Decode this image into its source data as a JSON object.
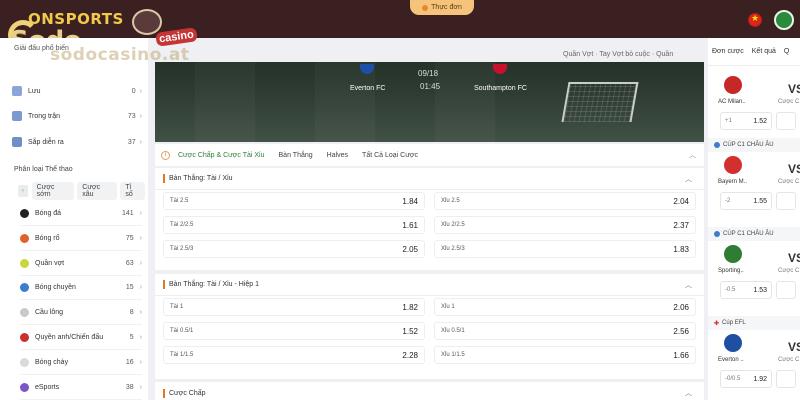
{
  "header": {
    "brand_top": "ONSPORTS",
    "brand_main": "Sodo",
    "brand_badge": "casino",
    "watermark": "sodocasino.at",
    "menu_label": "Thực đơn"
  },
  "sidebar": {
    "header": "Giải đấu phổ biến",
    "quick": [
      {
        "label": "Lưu",
        "count": "0"
      },
      {
        "label": "Trong trận",
        "count": "73"
      },
      {
        "label": "Sắp diễn ra",
        "count": "37"
      }
    ],
    "section_title": "Phân loại Thể thao",
    "filters": [
      "Cược sớm",
      "Cược xâu",
      "Tỉ số"
    ],
    "sports": [
      {
        "label": "Bóng đá",
        "count": "141",
        "color": "#222222"
      },
      {
        "label": "Bóng rổ",
        "count": "75",
        "color": "#e0622b"
      },
      {
        "label": "Quần vợt",
        "count": "63",
        "color": "#c6d83a"
      },
      {
        "label": "Bóng chuyền",
        "count": "15",
        "color": "#3b7bd0"
      },
      {
        "label": "Cầu lông",
        "count": "8",
        "color": "#c9c9c9"
      },
      {
        "label": "Quyền anh/Chiến đấu",
        "count": "5",
        "color": "#c93030"
      },
      {
        "label": "Bóng chày",
        "count": "16",
        "color": "#d9d9d9"
      },
      {
        "label": "eSports",
        "count": "38",
        "color": "#7a58c6"
      }
    ]
  },
  "crumb_right": "Quần Vợt · Tay Vợt bỏ cuộc · Quần",
  "match": {
    "home": "Everton FC",
    "away": "Southampton FC",
    "date": "09/18",
    "time": "01:45"
  },
  "market_tabs": [
    "Cược Chấp & Cược Tài Xỉu",
    "Bàn Thắng",
    "Halves",
    "Tất Cả Loại Cược"
  ],
  "markets": [
    {
      "title": "Bàn Thắng: Tài / Xỉu",
      "rows": [
        [
          {
            "label": "Tài 2.5",
            "value": "1.84"
          },
          {
            "label": "Xỉu 2.5",
            "value": "2.04"
          }
        ],
        [
          {
            "label": "Tài 2/2.5",
            "value": "1.61"
          },
          {
            "label": "Xỉu 2/2.5",
            "value": "2.37"
          }
        ],
        [
          {
            "label": "Tài 2.5/3",
            "value": "2.05"
          },
          {
            "label": "Xỉu 2.5/3",
            "value": "1.83"
          }
        ]
      ]
    },
    {
      "title": "Bàn Thắng: Tài / Xỉu - Hiệp 1",
      "rows": [
        [
          {
            "label": "Tài 1",
            "value": "1.82"
          },
          {
            "label": "Xỉu 1",
            "value": "2.06"
          }
        ],
        [
          {
            "label": "Tài 0.5/1",
            "value": "1.52"
          },
          {
            "label": "Xỉu 0.5/1",
            "value": "2.56"
          }
        ],
        [
          {
            "label": "Tài 1/1.5",
            "value": "2.28"
          },
          {
            "label": "Xỉu 1/1.5",
            "value": "1.66"
          }
        ]
      ]
    },
    {
      "title": "Cược Chấp",
      "rows": []
    }
  ],
  "right": {
    "tabs": [
      "Đơn cược",
      "Kết quả",
      "Q"
    ],
    "cards": [
      {
        "comp": "",
        "team": "AC Milan..",
        "crest": "#c62828",
        "vs": "VS",
        "sub": "Cược C",
        "hcap": "+1",
        "odd": "1.52"
      },
      {
        "comp": "CÚP C1 CHÂU ÂU",
        "team": "Bayern M..",
        "crest": "#d32f2f",
        "vs": "VS",
        "sub": "Cược C",
        "hcap": "-2",
        "odd": "1.55"
      },
      {
        "comp": "CÚP C1 CHÂU ÂU",
        "team": "Sporting..",
        "crest": "#2e7d32",
        "vs": "VS",
        "sub": "Cược C",
        "hcap": "-0.5",
        "odd": "1.53"
      },
      {
        "comp": "Cúp EFL",
        "team": "Everton ..",
        "crest": "#1e4fa3",
        "vs": "VS",
        "sub": "Cược C",
        "hcap": "-0/0.5",
        "odd": "1.92"
      }
    ]
  }
}
